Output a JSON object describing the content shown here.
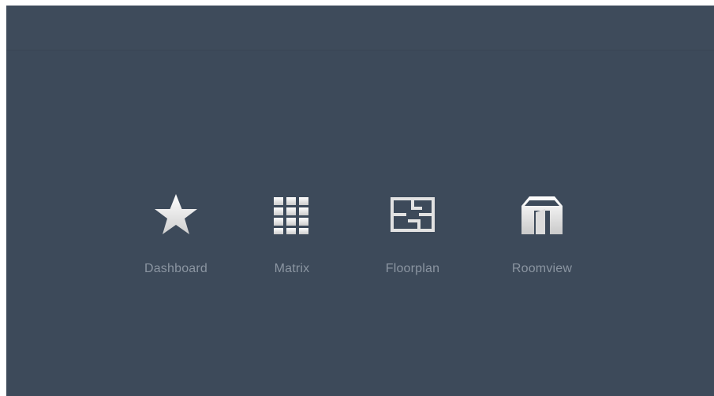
{
  "nav": {
    "items": [
      {
        "label": "Dashboard",
        "icon": "star-icon"
      },
      {
        "label": "Matrix",
        "icon": "grid-icon"
      },
      {
        "label": "Floorplan",
        "icon": "floorplan-icon"
      },
      {
        "label": "Roomview",
        "icon": "roomview-icon"
      }
    ]
  },
  "colors": {
    "background": "#3d4a5a",
    "label": "#8b95a1",
    "icon": "#e6e6e6"
  }
}
